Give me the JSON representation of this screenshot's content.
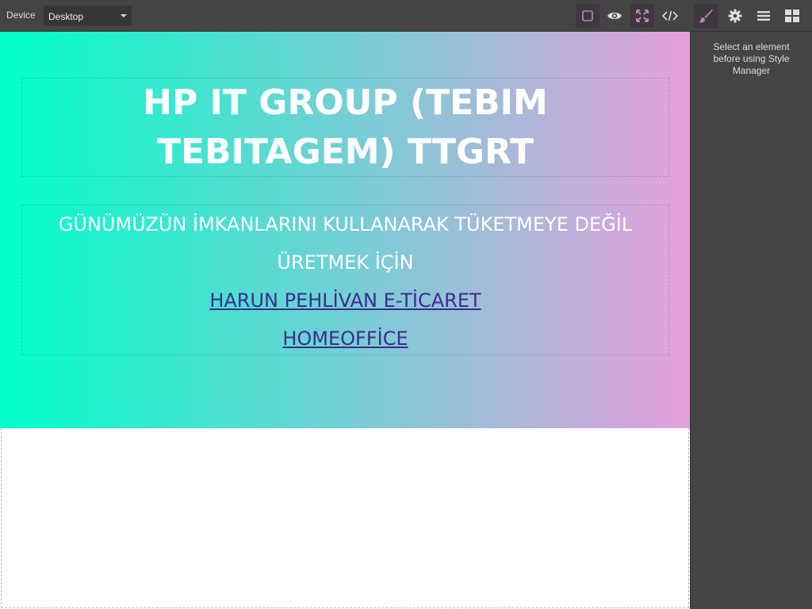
{
  "toolbar": {
    "device_label": "Device",
    "device_value": "Desktop",
    "icons": [
      "sw-visibility-icon",
      "preview-icon",
      "fullscreen-icon",
      "code-icon",
      "style-manager-icon",
      "settings-icon",
      "layer-manager-icon",
      "blocks-icon"
    ],
    "accent": "#d278c9"
  },
  "panel": {
    "message": "Select an element before using Style Manager"
  },
  "hero": {
    "gradient_start": "#00ffcc",
    "gradient_end": "#e69fdd",
    "title": "HP IT GROUP (TEBIM TEBITAGEM) TTGRT",
    "subtitle": "GÜNÜMÜZÜN İMKANLARINI KULLANARAK TÜKETMEYE DEĞİL ÜRETMEK İÇİN",
    "link1": "HARUN PEHLİVAN E-TİCARET",
    "link2": "HOMEOFFİCE"
  }
}
